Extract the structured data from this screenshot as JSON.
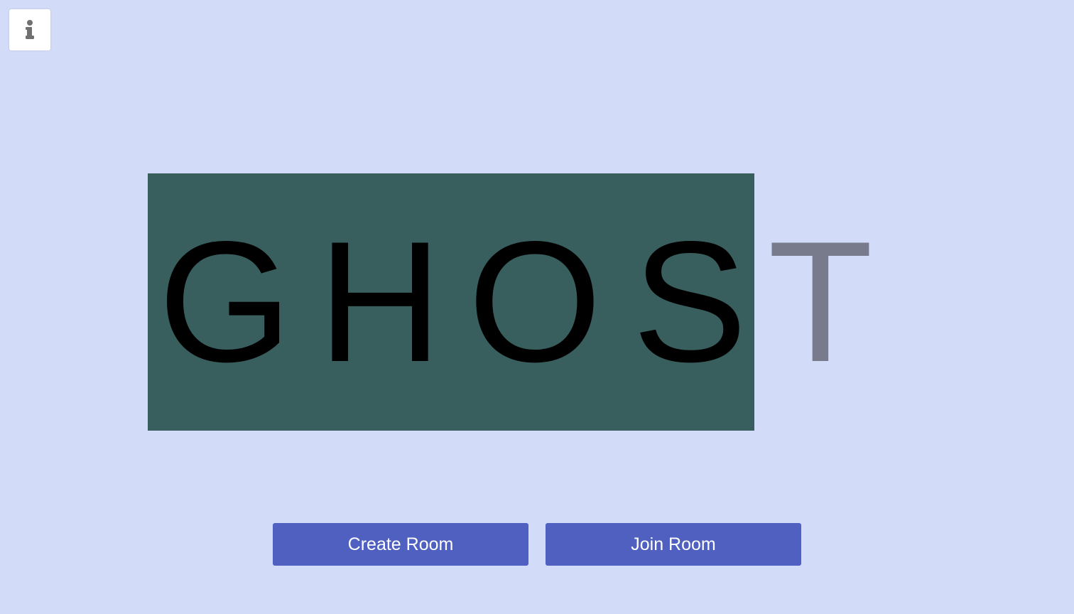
{
  "header": {
    "info_icon": "info-icon"
  },
  "logo": {
    "letters": [
      "G",
      "H",
      "O",
      "S",
      "T"
    ],
    "highlight_color": "#385f5d",
    "typed_color": "#000000",
    "remaining_color": "#777b8c"
  },
  "actions": {
    "create_label": "Create Room",
    "join_label": "Join Room",
    "button_color": "#5060c0"
  },
  "colors": {
    "background": "#d2dbf8"
  }
}
